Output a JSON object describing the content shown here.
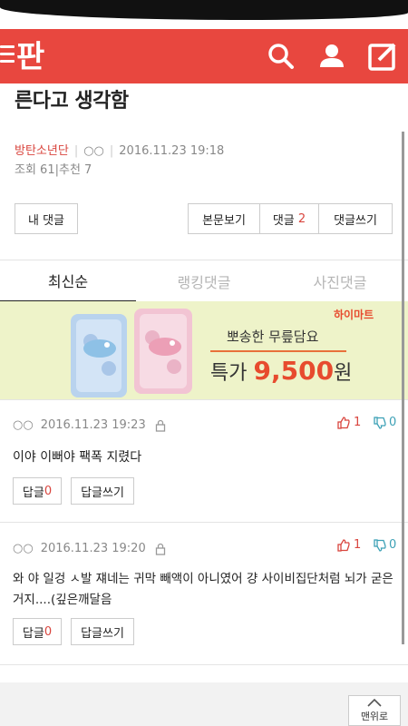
{
  "app": {
    "logo_text": "판"
  },
  "post": {
    "title_tail": "른다고 생각함",
    "author": "방탄소년단",
    "author_tag": "○○",
    "datetime": "2016.11.23 19:18",
    "views": "조회 61",
    "recommends": "추천 7"
  },
  "actions": {
    "my_comments": "내 댓글",
    "view_original": "본문보기",
    "comments_label": "댓글",
    "comments_count": "2",
    "write_comment": "댓글쓰기"
  },
  "tabs": [
    "최신순",
    "랭킹댓글",
    "사진댓글"
  ],
  "banner": {
    "brand": "하이마트",
    "line1": "뽀송한 무릎담요",
    "line2_prefix": "특가",
    "price": "9,500",
    "unit": "원"
  },
  "comments": [
    {
      "author": "○○",
      "datetime": "2016.11.23 19:23",
      "text": "이야 이뻐야 팩폭 지렸다",
      "likes": "1",
      "dislikes": "0",
      "reply_label": "답글",
      "reply_count": "0",
      "write_reply": "답글쓰기"
    },
    {
      "author": "○○",
      "datetime": "2016.11.23 19:20",
      "text": "와 야 일겅 ㅅ발 쟤네는 귀막 빼액이 아니였어 걍 사이비집단처럼 뇌가 굳은거지....(깊은깨달음",
      "likes": "1",
      "dislikes": "0",
      "reply_label": "답글",
      "reply_count": "0",
      "write_reply": "답글쓰기"
    }
  ],
  "footer": {
    "top_label": "맨위로"
  },
  "colors": {
    "brand_red": "#e8473f",
    "like_red": "#d9453e",
    "dislike_teal": "#3da1b6"
  }
}
